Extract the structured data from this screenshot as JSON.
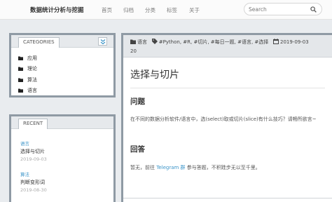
{
  "brand": "数据统计分析与挖掘",
  "nav": {
    "items": [
      "首页",
      "归档",
      "分类",
      "标签",
      "关于"
    ]
  },
  "search": {
    "placeholder": "Search"
  },
  "categories": {
    "title": "CATEGORIES",
    "items": [
      "应用",
      "理论",
      "算法",
      "语言"
    ]
  },
  "recent": {
    "title": "RECENT",
    "posts": [
      {
        "category": "语言",
        "title": "选择与切片",
        "date": "2019-09-03"
      },
      {
        "category": "算法",
        "title": "判断变形词",
        "date": "2019-08-30"
      }
    ]
  },
  "article": {
    "meta_category": "语言",
    "meta_tags": "#Python, #R, #切片, #每日一题, #语言, #选择",
    "meta_date_a": "2019-09-03",
    "meta_date_b": "20",
    "title": "选择与切片",
    "section1": "问题",
    "question": "在不同的数据分析软件/语言中，选(select)取或切片(slice)有什么技巧？请畅所欲言~",
    "section2": "回答",
    "answer_pre": "暂无，前往",
    "answer_link": "Telegram 群",
    "answer_post": "参与答题，不积跬步无以至千里。"
  },
  "colors": {
    "accent": "#3c95c9",
    "panel_border": "#8f9aa4",
    "background": "#e9ecef"
  },
  "icons": {
    "search": "search-icon",
    "collapse": "chevron-double-down-icon",
    "folder": "folder-icon",
    "tag": "tag-icon",
    "calendar": "calendar-icon"
  }
}
